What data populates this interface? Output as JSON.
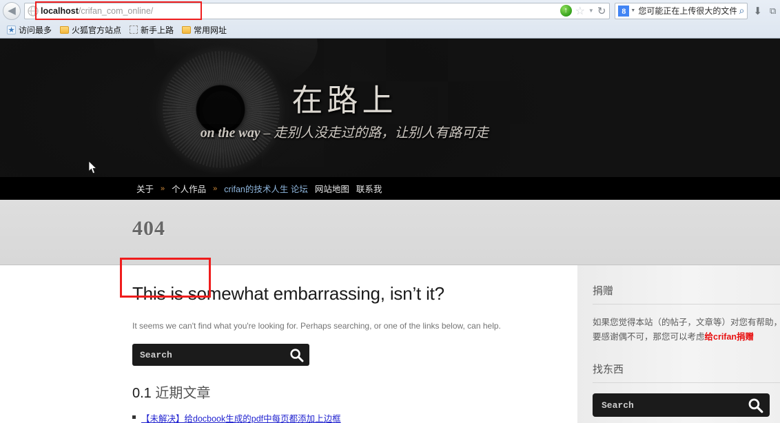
{
  "browser": {
    "back_label": "◀",
    "url": {
      "host": "localhost",
      "path": "/crifan_com_online/"
    },
    "go_icon": "↑",
    "star_icon": "☆",
    "dropmarker_icon": "▼",
    "reload_icon": "↻",
    "search_engine_letter": "8",
    "search_engine_arrow": "▼",
    "search_text": "您可能正在上传很大的文件，请稍",
    "search_go_icon": "⌕",
    "download_icon": "⬇",
    "overflow_icon": "⧉",
    "bookmarks": [
      {
        "label": "访问最多",
        "icon": "most-visited-icon"
      },
      {
        "label": "火狐官方站点",
        "icon": "folder-icon"
      },
      {
        "label": "新手上路",
        "icon": "dashed-folder-icon"
      },
      {
        "label": "常用网址",
        "icon": "folder-icon"
      }
    ]
  },
  "site": {
    "title": "在路上",
    "tagline_en": "on the way",
    "tagline_dash": " – ",
    "tagline_cn": "走别人没走过的路，让别人有路可走",
    "nav": [
      {
        "label": "关于",
        "sep": "»",
        "accent": false
      },
      {
        "label": "个人作品",
        "sep": "»",
        "accent": false
      },
      {
        "label": "crifan的技术人生 论坛",
        "sep": "",
        "accent": true
      },
      {
        "label": "网站地图",
        "sep": "",
        "accent": false
      },
      {
        "label": "联系我",
        "sep": "",
        "accent": false
      }
    ]
  },
  "breadcrumb": {
    "error_code": "404"
  },
  "main": {
    "heading": "This is somewhat embarrassing, isn’t it?",
    "subtext": "It seems we can't find what you're looking for. Perhaps searching, or one of the links below, can help.",
    "search_placeholder": "Search",
    "search_value": "",
    "recent_heading_num": "0.1",
    "recent_heading_text": "近期文章",
    "recent_posts": [
      "【未解决】给docbook生成的pdf中每页都添加上边框"
    ]
  },
  "sidebar": {
    "donate_title": "捐赠",
    "donate_line1": "如果您觉得本站（的帖子，文章等）对您有帮助，觉",
    "donate_line2_pre": "要感谢偶不可，那您可以考虑",
    "donate_link": "给crifan捐赠",
    "find_title": "找东西",
    "search_placeholder": "Search",
    "search_value": ""
  },
  "colors": {
    "annotation_red": "#ef1c1c",
    "donate_red": "#e81010",
    "link_blue": "#2224d0",
    "nav_accent": "#8fb6dd",
    "banner_bg": "#131313"
  }
}
